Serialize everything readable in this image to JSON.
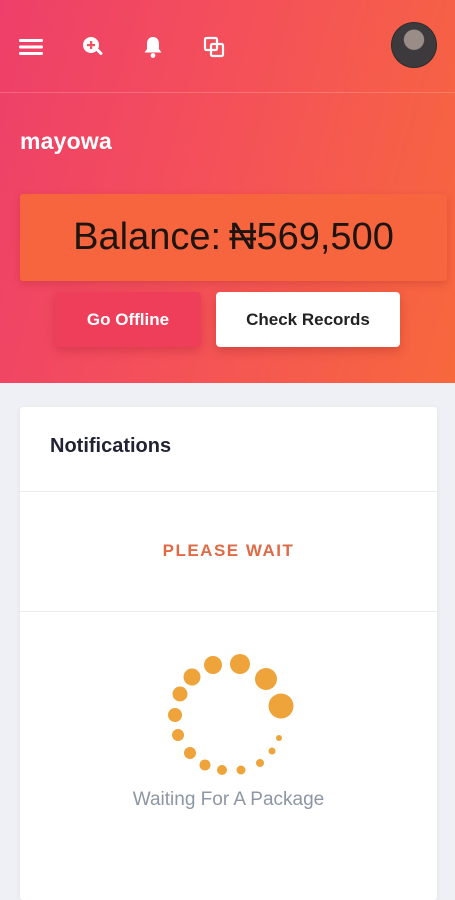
{
  "header": {
    "icons": [
      "menu-icon",
      "search-plus-icon",
      "bell-icon",
      "copy-icon"
    ],
    "avatar": "user-avatar"
  },
  "profile": {
    "username": "mayowa"
  },
  "balance": {
    "label": "Balance:",
    "amount": "₦569,500"
  },
  "actions": {
    "go_offline": "Go Offline",
    "check_records": "Check Records"
  },
  "notifications": {
    "title": "Notifications",
    "status": "PLEASE WAIT",
    "message": "Waiting For A Package"
  },
  "colors": {
    "gradient_start": "#ee3f6a",
    "gradient_end": "#f7683c",
    "balance_bg": "#f6653d",
    "offline_button": "#ee3e5a",
    "status_text": "#e06a45",
    "spinner": "#eea43a"
  }
}
